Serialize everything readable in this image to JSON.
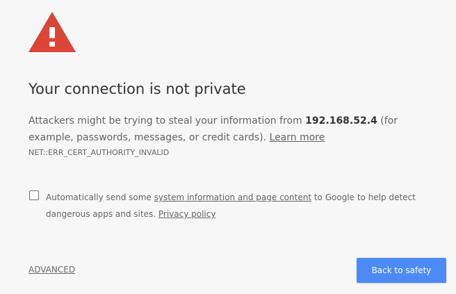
{
  "interstitial": {
    "heading": "Your connection is not private",
    "message_before_host": "Attackers might be trying to steal your information from ",
    "host": "192.168.52.4",
    "message_after_host": " (for example, passwords, messages, or credit cards). ",
    "learn_more_label": "Learn more",
    "error_code": "NET::ERR_CERT_AUTHORITY_INVALID",
    "icon": "warning-triangle-icon",
    "icon_color": "#db4437"
  },
  "optin": {
    "checked": false,
    "text_before_link": "Automatically send some ",
    "link_label": "system information and page content",
    "text_after_link": " to Google to help detect dangerous apps and sites. ",
    "privacy_label": "Privacy policy"
  },
  "actions": {
    "advanced_label": "ADVANCED",
    "safety_label": "Back to safety",
    "safety_color": "#4c8bf5"
  }
}
